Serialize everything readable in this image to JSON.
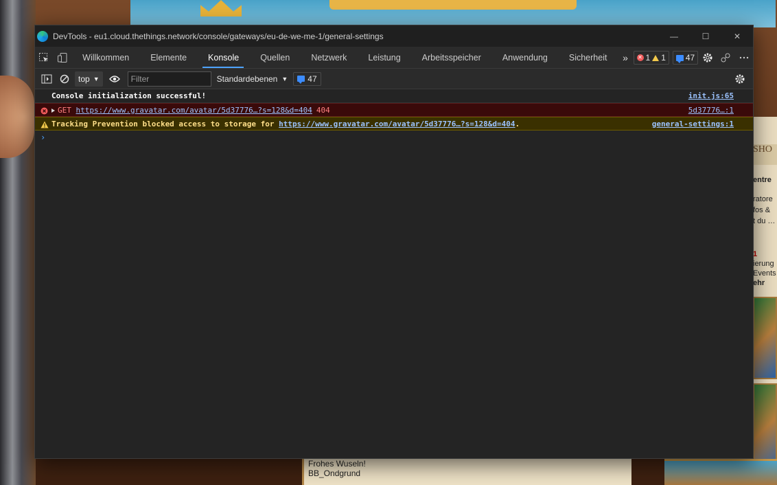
{
  "background_page": {
    "sidebar_lines": [
      "entre",
      "ratore",
      "fos &",
      "t du …",
      "1",
      "ierung",
      "Events",
      "ehr"
    ],
    "shop_label": "SHO",
    "note_lines": [
      "Frohes Wuseln!",
      "BB_Ondgrund"
    ]
  },
  "window": {
    "title": "DevTools - eu1.cloud.thethings.network/console/gateways/eu-de-we-me-1/general-settings",
    "minimize": "—",
    "maximize": "☐",
    "close": "✕"
  },
  "tabs": [
    {
      "label": "Willkommen"
    },
    {
      "label": "Elemente"
    },
    {
      "label": "Konsole",
      "active": true
    },
    {
      "label": "Quellen"
    },
    {
      "label": "Netzwerk"
    },
    {
      "label": "Leistung"
    },
    {
      "label": "Arbeitsspeicher"
    },
    {
      "label": "Anwendung"
    },
    {
      "label": "Sicherheit"
    }
  ],
  "tab_overflow": "»",
  "issue_counts": {
    "errors": "1",
    "warnings": "1",
    "messages": "47"
  },
  "toolbar": {
    "context": "top",
    "filter_placeholder": "Filter",
    "levels": "Standardebenen",
    "message_count": "47"
  },
  "console": {
    "log": {
      "text": "Console initialization successful!",
      "source": "init.js:65"
    },
    "error": {
      "method": "GET",
      "url": "https://www.gravatar.com/avatar/5d37776…?s=128&d=404",
      "status": "404",
      "source": "5d37776…:1"
    },
    "warning": {
      "text": "Tracking Prevention blocked access to storage for",
      "url": "https://www.gravatar.com/avatar/5d37776…?s=128&d=404",
      "suffix": ".",
      "source": "general-settings:1"
    },
    "prompt": "›"
  },
  "colors": {
    "accent": "#4da3ff",
    "error": "#f15b5b",
    "warning": "#f2c94c",
    "background": "#242424"
  }
}
